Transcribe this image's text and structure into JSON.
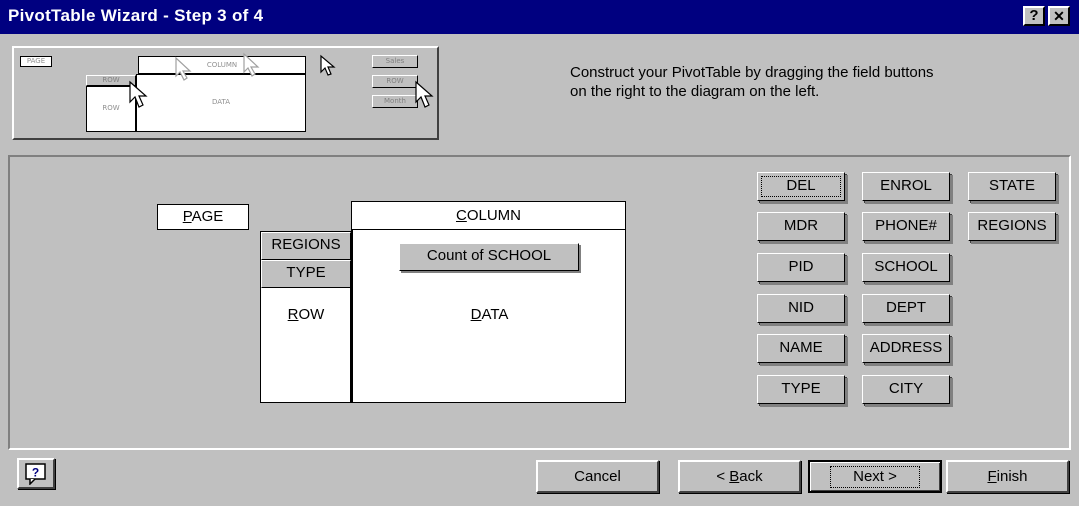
{
  "window": {
    "title": "PivotTable Wizard - Step 3 of 4",
    "help_button": "?",
    "close_button": "✕"
  },
  "preview": {
    "page": "PAGE",
    "column": "COLUMN",
    "row_btn": "ROW",
    "row": "ROW",
    "data": "DATA",
    "side_buttons": [
      "Sales",
      "ROW",
      "Month"
    ]
  },
  "instructions": "Construct your PivotTable by dragging the field buttons on the right to the diagram on the left.",
  "layout": {
    "page_label_pre": "",
    "page_label_u": "P",
    "page_label_post": "AGE",
    "column_label_u": "C",
    "column_label_post": "OLUMN",
    "row_label_u": "R",
    "row_label_post": "OW",
    "data_label_u": "D",
    "data_label_post": "ATA",
    "row_fields": [
      "REGIONS",
      "TYPE"
    ],
    "data_fields": [
      "Count of SCHOOL"
    ]
  },
  "field_buttons": [
    [
      "DEL",
      "ENROL",
      "STATE"
    ],
    [
      "MDR",
      "PHONE#",
      "REGIONS"
    ],
    [
      "PID",
      "SCHOOL"
    ],
    [
      "NID",
      "DEPT"
    ],
    [
      "NAME",
      "ADDRESS"
    ],
    [
      "TYPE",
      "CITY"
    ]
  ],
  "buttons": {
    "help_icon": "?",
    "cancel": "Cancel",
    "back_pre": "< ",
    "back_u": "B",
    "back_post": "ack",
    "next": "Next >",
    "finish_u": "F",
    "finish_post": "inish"
  }
}
